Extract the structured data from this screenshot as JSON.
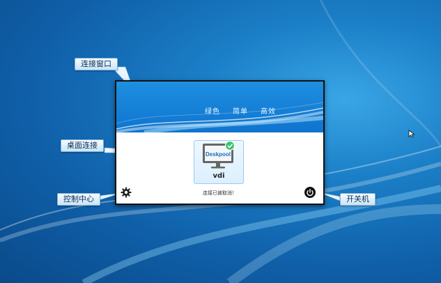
{
  "callouts": {
    "window": "连接窗口",
    "desktop": "桌面连接",
    "control": "控制中心",
    "power": "开关机"
  },
  "window": {
    "slogans": [
      "绿色",
      "简单",
      "高效"
    ],
    "desktop_tile": {
      "logo_text": "Deskpool",
      "name": "vdi"
    },
    "status": "连接已被取消！"
  },
  "icons": {
    "settings": "gear-icon",
    "power": "power-icon",
    "connected": "check-icon",
    "monitor": "monitor-icon"
  },
  "colors": {
    "header": "#1584d8",
    "accent_green": "#3cc36a",
    "desktop_bg": "#0f5fa8"
  }
}
